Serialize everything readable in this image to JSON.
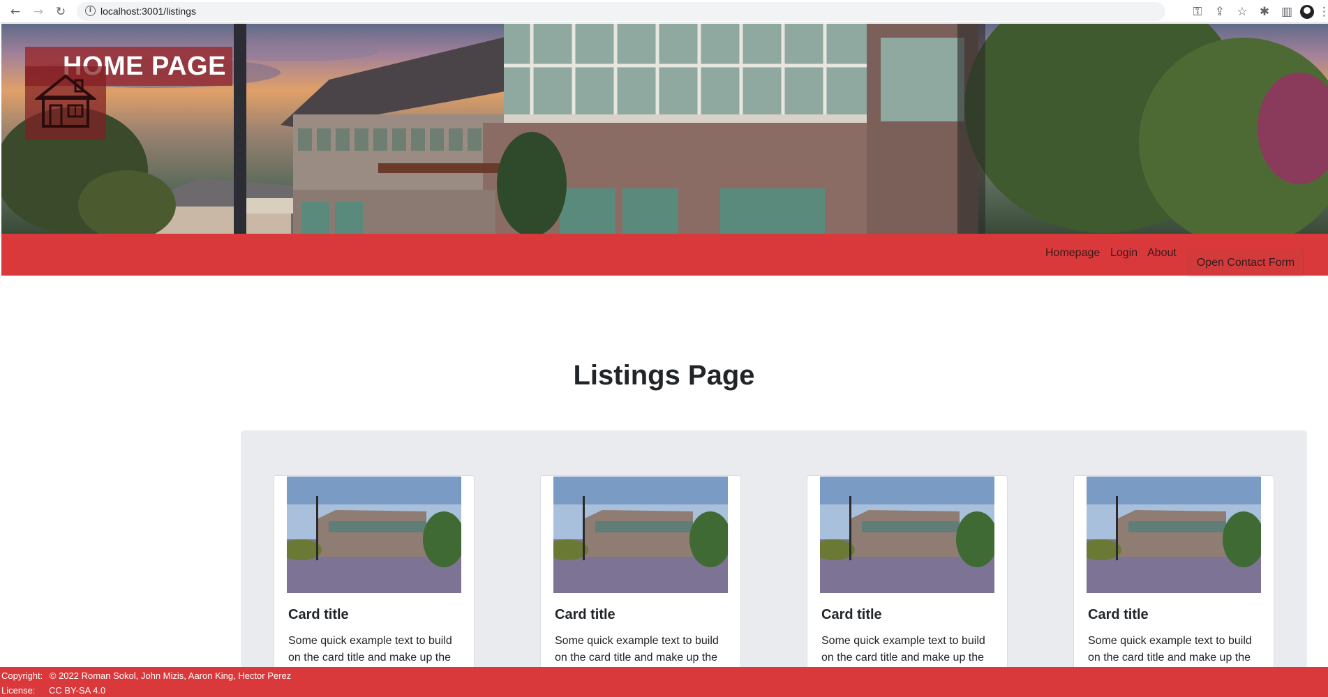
{
  "browser": {
    "url": "localhost:3001/listings",
    "back_icon": "←",
    "forward_icon": "→",
    "reload_icon": "↻",
    "info_icon": "i",
    "key_icon": "⚿",
    "share_icon": "⇪",
    "star_icon": "☆",
    "extensions_icon": "✱",
    "sidepanel_icon": "▥",
    "menu_icon": "⋮"
  },
  "header": {
    "title": "HOME PAGE"
  },
  "navbar": {
    "links": [
      "Homepage",
      "Login",
      "About"
    ],
    "contact_button": "Open Contact Form"
  },
  "main": {
    "title": "Listings Page",
    "cards": [
      {
        "title": "Card title",
        "text": "Some quick example text to build on the card title and make up the"
      },
      {
        "title": "Card title",
        "text": "Some quick example text to build on the card title and make up the"
      },
      {
        "title": "Card title",
        "text": "Some quick example text to build on the card title and make up the"
      },
      {
        "title": "Card title",
        "text": "Some quick example text to build on the card title and make up the"
      }
    ]
  },
  "footer": {
    "copyright_label": "Copyright:",
    "copyright_text": "© 2022 Roman Sokol, John Mizis, Aaron King, Hector Perez",
    "license_label": "License:",
    "license_text": "CC BY-SA 4.0"
  },
  "colors": {
    "brand_red": "#d9393b",
    "cards_background": "#e9ebee"
  }
}
